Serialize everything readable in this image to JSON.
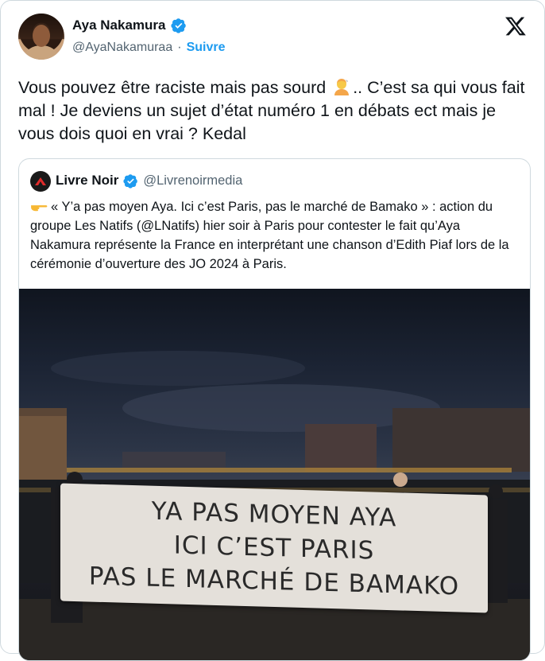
{
  "header": {
    "name": "Aya Nakamura",
    "handle": "@AyaNakamuraa",
    "separator": "·",
    "follow_label": "Suivre",
    "verified_icon": "verified-badge-icon",
    "platform_icon": "x-logo-icon"
  },
  "tweet": {
    "text_part1": "Vous pouvez être raciste mais pas sourd ",
    "emoji": "man-emoji-icon",
    "text_part2": ".. C’est sa qui vous fait mal ! Je deviens un sujet d’état numéro 1 en débats ect mais je vous dois quoi en vrai ? Kedal"
  },
  "quote": {
    "name": "Livre Noir",
    "handle": "@Livrenoirmedia",
    "pointer_icon": "pointing-hand-icon",
    "text": "« Y’a pas moyen Aya. Ici c’est Paris, pas le marché de Bamako » : action du groupe Les Natifs (@LNatifs) hier soir à Paris pour contester le fait qu’Aya Nakamura représente la France en interprétant une chanson d’Edith Piaf lors de la cérémonie d’ouverture des JO 2024 à Paris.",
    "banner": {
      "line1": "YA PAS MOYEN AYA",
      "line2": "ICI C’EST PARIS",
      "line3": "PAS LE MARCHÉ DE BAMAKO"
    }
  },
  "colors": {
    "accent": "#1d9bf0",
    "text": "#0f1419",
    "muted": "#536471",
    "border": "#cfd9de"
  }
}
